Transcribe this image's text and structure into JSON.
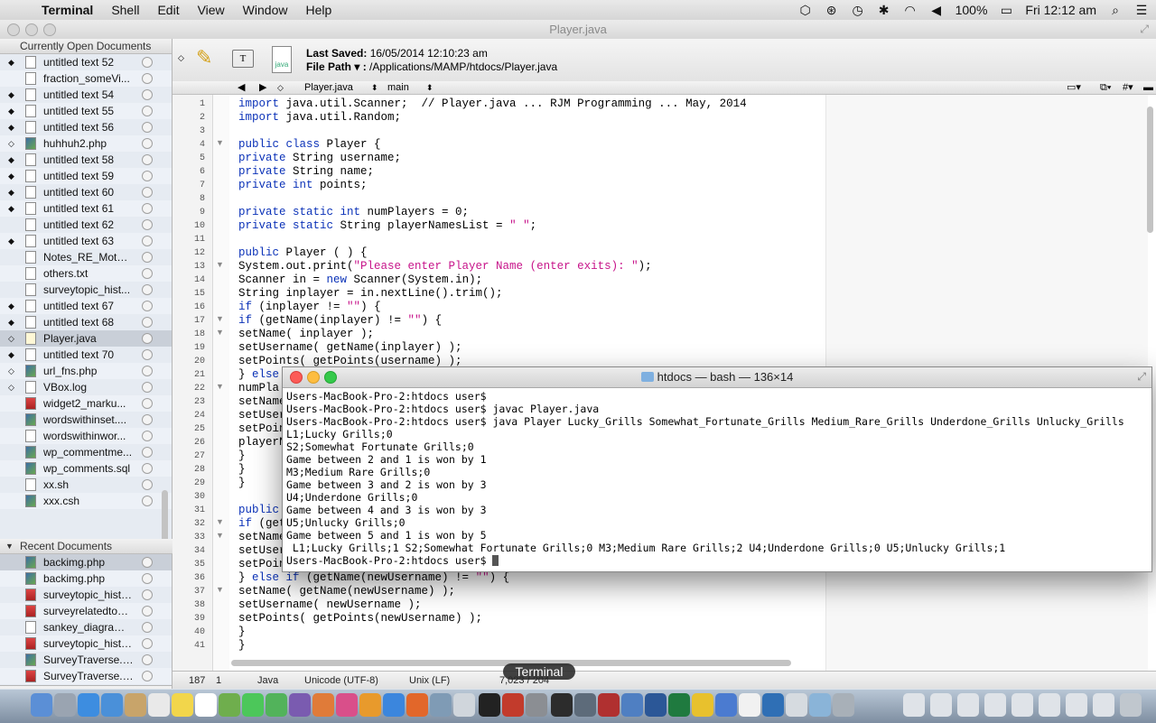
{
  "menubar": {
    "app": "Terminal",
    "items": [
      "Shell",
      "Edit",
      "View",
      "Window",
      "Help"
    ],
    "battery": "100%",
    "clock": "Fri 12:12 am"
  },
  "editor": {
    "window_title": "Player.java",
    "last_saved_label": "Last Saved:",
    "last_saved_value": "16/05/2014 12:10:23 am",
    "file_path_label": "File Path ▾ :",
    "file_path_value": "/Applications/MAMP/htdocs/Player.java",
    "nav_file": "Player.java",
    "nav_symbol": "main",
    "sidebar": {
      "open_header": "Currently Open Documents",
      "open_docs": [
        {
          "name": "untitled text 52",
          "mark": "◆",
          "icon": "doc"
        },
        {
          "name": "fraction_someVi...",
          "mark": "",
          "icon": "doc"
        },
        {
          "name": "untitled text 54",
          "mark": "◆",
          "icon": "doc"
        },
        {
          "name": "untitled text 55",
          "mark": "◆",
          "icon": "doc"
        },
        {
          "name": "untitled text 56",
          "mark": "◆",
          "icon": "doc"
        },
        {
          "name": "huhhuh2.php",
          "mark": "◇",
          "icon": "img"
        },
        {
          "name": "untitled text 58",
          "mark": "◆",
          "icon": "doc"
        },
        {
          "name": "untitled text 59",
          "mark": "◆",
          "icon": "doc"
        },
        {
          "name": "untitled text 60",
          "mark": "◆",
          "icon": "doc"
        },
        {
          "name": "untitled text 61",
          "mark": "◆",
          "icon": "doc"
        },
        {
          "name": "untitled text 62",
          "mark": "",
          "icon": "doc"
        },
        {
          "name": "untitled text 63",
          "mark": "◆",
          "icon": "doc"
        },
        {
          "name": "Notes_RE_Mothe...",
          "mark": "",
          "icon": "doc"
        },
        {
          "name": "others.txt",
          "mark": "",
          "icon": "doc"
        },
        {
          "name": "surveytopic_hist...",
          "mark": "",
          "icon": "doc"
        },
        {
          "name": "untitled text 67",
          "mark": "◆",
          "icon": "doc"
        },
        {
          "name": "untitled text 68",
          "mark": "◆",
          "icon": "doc"
        },
        {
          "name": "Player.java",
          "mark": "◇",
          "icon": "java",
          "selected": true
        },
        {
          "name": "untitled text 70",
          "mark": "◆",
          "icon": "doc"
        },
        {
          "name": "url_fns.php",
          "mark": "◇",
          "icon": "img"
        },
        {
          "name": "VBox.log",
          "mark": "◇",
          "icon": "doc"
        },
        {
          "name": "widget2_marku...",
          "mark": "",
          "icon": "red"
        },
        {
          "name": "wordswithinset....",
          "mark": "",
          "icon": "img"
        },
        {
          "name": "wordswithinwor...",
          "mark": "",
          "icon": "doc"
        },
        {
          "name": "wp_commentme...",
          "mark": "",
          "icon": "img"
        },
        {
          "name": "wp_comments.sql",
          "mark": "",
          "icon": "img"
        },
        {
          "name": "xx.sh",
          "mark": "",
          "icon": "doc"
        },
        {
          "name": "xxx.csh",
          "mark": "",
          "icon": "img"
        }
      ],
      "recent_header": "Recent Documents",
      "recent_docs": [
        {
          "name": "backimg.php",
          "icon": "img",
          "selected": true
        },
        {
          "name": "backimg.php",
          "icon": "img"
        },
        {
          "name": "surveytopic_histogr...",
          "icon": "red"
        },
        {
          "name": "surveyrelatedtopic_s...",
          "icon": "red"
        },
        {
          "name": "sankey_diagram.ph...",
          "icon": "doc"
        },
        {
          "name": "surveytopic_histogr...",
          "icon": "red"
        },
        {
          "name": "SurveyTraverse.php",
          "icon": "img"
        },
        {
          "name": "SurveyTraverse.html",
          "icon": "red"
        }
      ]
    },
    "line_numbers": [
      "1",
      "2",
      "3",
      "4",
      "5",
      "6",
      "7",
      "8",
      "9",
      "10",
      "11",
      "12",
      "13",
      "14",
      "15",
      "16",
      "17",
      "18",
      "19",
      "20",
      "21",
      "22",
      "23",
      "24",
      "25",
      "26",
      "27",
      "28",
      "29",
      "30",
      "31",
      "32",
      "33",
      "34",
      "35",
      "36",
      "37",
      "38",
      "39",
      "40",
      "41"
    ],
    "code_lines": [
      [
        {
          "t": "import",
          "c": "kw"
        },
        {
          "t": " java.util.Scanner;  // Player.java ... RJM Programming ... May, 2014"
        }
      ],
      [
        {
          "t": "import",
          "c": "kw"
        },
        {
          "t": " java.util.Random;"
        }
      ],
      [
        {
          "t": ""
        }
      ],
      [
        {
          "t": "public class",
          "c": "kw"
        },
        {
          "t": " Player {"
        }
      ],
      [
        {
          "t": "private",
          "c": "kw"
        },
        {
          "t": " String username;"
        }
      ],
      [
        {
          "t": "private",
          "c": "kw"
        },
        {
          "t": " String name;"
        }
      ],
      [
        {
          "t": "private int",
          "c": "kw"
        },
        {
          "t": " points;"
        }
      ],
      [
        {
          "t": ""
        }
      ],
      [
        {
          "t": "private static int",
          "c": "kw"
        },
        {
          "t": " numPlayers = 0;"
        }
      ],
      [
        {
          "t": "private static",
          "c": "kw"
        },
        {
          "t": " String playerNamesList = "
        },
        {
          "t": "\" \"",
          "c": "str"
        },
        {
          "t": ";"
        }
      ],
      [
        {
          "t": ""
        }
      ],
      [
        {
          "t": "public",
          "c": "kw"
        },
        {
          "t": " Player ( ) {"
        }
      ],
      [
        {
          "t": "System.out.print("
        },
        {
          "t": "\"Please enter Player Name (enter exits): \"",
          "c": "str"
        },
        {
          "t": ");"
        }
      ],
      [
        {
          "t": "Scanner in = "
        },
        {
          "t": "new",
          "c": "kw"
        },
        {
          "t": " Scanner(System.in);"
        }
      ],
      [
        {
          "t": "String inplayer = in.nextLine().trim();"
        }
      ],
      [
        {
          "t": "if",
          "c": "kw"
        },
        {
          "t": " (inplayer != "
        },
        {
          "t": "\"\"",
          "c": "str"
        },
        {
          "t": ") {"
        }
      ],
      [
        {
          "t": "if",
          "c": "kw"
        },
        {
          "t": " (getName(inplayer) != "
        },
        {
          "t": "\"\"",
          "c": "str"
        },
        {
          "t": ") {"
        }
      ],
      [
        {
          "t": "setName( inplayer );"
        }
      ],
      [
        {
          "t": "setUsername( getName(inplayer) );"
        }
      ],
      [
        {
          "t": "setPoints( getPoints(username) );"
        }
      ],
      [
        {
          "t": "} "
        },
        {
          "t": "else",
          "c": "kw"
        }
      ],
      [
        {
          "t": "numPla"
        }
      ],
      [
        {
          "t": "setName"
        }
      ],
      [
        {
          "t": "setUser"
        }
      ],
      [
        {
          "t": "setPoin"
        }
      ],
      [
        {
          "t": "playerN"
        }
      ],
      [
        {
          "t": "}"
        }
      ],
      [
        {
          "t": "}"
        }
      ],
      [
        {
          "t": "}"
        }
      ],
      [
        {
          "t": ""
        }
      ],
      [
        {
          "t": "public",
          "c": "kw"
        }
      ],
      [
        {
          "t": "if",
          "c": "kw"
        },
        {
          "t": " (get"
        }
      ],
      [
        {
          "t": "setName"
        }
      ],
      [
        {
          "t": "setUser"
        }
      ],
      [
        {
          "t": "setPoin"
        }
      ],
      [
        {
          "t": "} "
        },
        {
          "t": "else if",
          "c": "kw"
        },
        {
          "t": " (getName(newUsername) != "
        },
        {
          "t": "\"\"",
          "c": "str"
        },
        {
          "t": ") {"
        }
      ],
      [
        {
          "t": "setName( getName(newUsername) );"
        }
      ],
      [
        {
          "t": "setUsername( newUsername );"
        }
      ],
      [
        {
          "t": "setPoints( getPoints(newUsername) );"
        }
      ],
      [
        {
          "t": "}"
        }
      ],
      [
        {
          "t": "}"
        }
      ]
    ],
    "status": {
      "line": "187",
      "col": "1",
      "language": "Java",
      "encoding": "Unicode (UTF-8)",
      "line_endings": "Unix (LF)",
      "counts": "7,023 / 204"
    }
  },
  "terminal": {
    "title": "htdocs — bash — 136×14",
    "lines": [
      "Users-MacBook-Pro-2:htdocs user$",
      "Users-MacBook-Pro-2:htdocs user$ javac Player.java",
      "Users-MacBook-Pro-2:htdocs user$ java Player Lucky_Grills Somewhat_Fortunate_Grills Medium_Rare_Grills Underdone_Grills Unlucky_Grills",
      "L1;Lucky Grills;0",
      "S2;Somewhat Fortunate Grills;0",
      "Game between 2 and 1 is won by 1",
      "M3;Medium Rare Grills;0",
      "Game between 3 and 2 is won by 3",
      "U4;Underdone Grills;0",
      "Game between 4 and 3 is won by 3",
      "U5;Unlucky Grills;0",
      "Game between 5 and 1 is won by 5",
      " L1;Lucky Grills;1 S2;Somewhat Fortunate Grills;0 M3;Medium Rare Grills;2 U4;Underdone Grills;0 U5;Unlucky Grills;1"
    ],
    "prompt": "Users-MacBook-Pro-2:htdocs user$ "
  },
  "dock": {
    "tooltip": "Terminal",
    "icons": [
      "finder-icon",
      "launchpad-icon",
      "safari-icon",
      "mail-icon",
      "contacts-icon",
      "calendar-icon",
      "notes-icon",
      "reminders-icon",
      "photo-icon",
      "messages-icon",
      "facetime-icon",
      "imovie-icon",
      "garageband-icon",
      "itunes-icon",
      "ibooks-icon",
      "appstore-icon",
      "firefox-icon",
      "textwrangler-icon",
      "preview-icon",
      "terminal-icon",
      "filezilla-icon",
      "system-prefs-icon",
      "dashboard-icon",
      "mission-control-icon",
      "photobooth-icon",
      "keynote-icon",
      "word-icon",
      "excel-icon",
      "chrome-icon",
      "spotlight-icon",
      "textedit-icon",
      "xcode-icon",
      "document-icon",
      "folder-icon",
      "trash-icon"
    ]
  }
}
